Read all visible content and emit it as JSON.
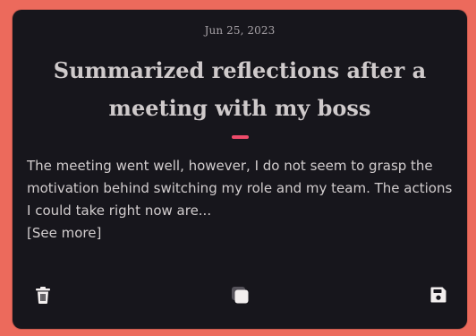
{
  "card": {
    "date": "Jun 25, 2023",
    "title": "Summarized reflections after a meeting with my boss",
    "excerpt": "The meeting went well, however, I do not seem to grasp the motivation behind switching my role and my team. The actions I could take right now are...",
    "see_more": "[See more]"
  },
  "actions": {
    "delete_icon": "trash-icon",
    "copy_icon": "copy-icon",
    "save_icon": "floppy-disk-icon"
  },
  "colors": {
    "page_background": "#ec6a5c",
    "card_background": "#17161c",
    "accent": "#ee4b6a",
    "text": "#d2cdce"
  }
}
